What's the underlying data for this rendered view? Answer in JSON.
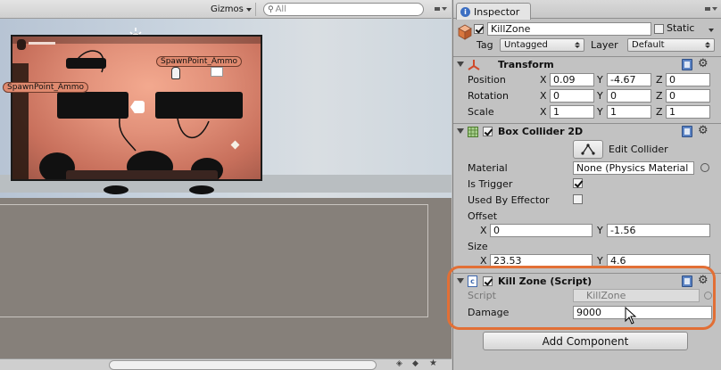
{
  "scene": {
    "toolbar": {
      "gizmos_label": "Gizmos",
      "search_placeholder": "All"
    },
    "spawn_labels": [
      "SpawnPoint_Ammo",
      "SpawnPoint_Ammo"
    ]
  },
  "inspector": {
    "tab_label": "Inspector",
    "gameobject": {
      "active": true,
      "name": "KillZone",
      "static_label": "Static",
      "static_checked": false,
      "tag_label": "Tag",
      "tag_value": "Untagged",
      "layer_label": "Layer",
      "layer_value": "Default"
    },
    "transform": {
      "title": "Transform",
      "position_label": "Position",
      "position": {
        "x": "0.09",
        "y": "-4.67",
        "z": "0"
      },
      "rotation_label": "Rotation",
      "rotation": {
        "x": "0",
        "y": "0",
        "z": "0"
      },
      "scale_label": "Scale",
      "scale": {
        "x": "1",
        "y": "1",
        "z": "1"
      },
      "axis_x": "X",
      "axis_y": "Y",
      "axis_z": "Z"
    },
    "box_collider": {
      "title": "Box Collider 2D",
      "enabled": true,
      "edit_collider_label": "Edit Collider",
      "material_label": "Material",
      "material_value": "None (Physics Material",
      "is_trigger_label": "Is Trigger",
      "is_trigger": true,
      "used_by_effector_label": "Used By Effector",
      "used_by_effector": false,
      "offset_label": "Offset",
      "offset": {
        "x": "0",
        "y": "-1.56"
      },
      "size_label": "Size",
      "size": {
        "x": "23.53",
        "y": "4.6"
      }
    },
    "kill_zone": {
      "title": "Kill Zone (Script)",
      "enabled": true,
      "script_label": "Script",
      "script_value": "KillZone",
      "damage_label": "Damage",
      "damage_value": "9000"
    },
    "add_component_label": "Add Component"
  },
  "colors": {
    "highlight": "#e26f35",
    "game_bg": "#e2917a",
    "panel_bg": "#c2c2c2"
  },
  "icons": [
    "cube-icon",
    "transform-axes-icon",
    "collider-grid-icon",
    "script-icon",
    "book-icon",
    "gear-icon",
    "edit-collider-icon",
    "sun-icon",
    "mouse-cursor-icon"
  ]
}
